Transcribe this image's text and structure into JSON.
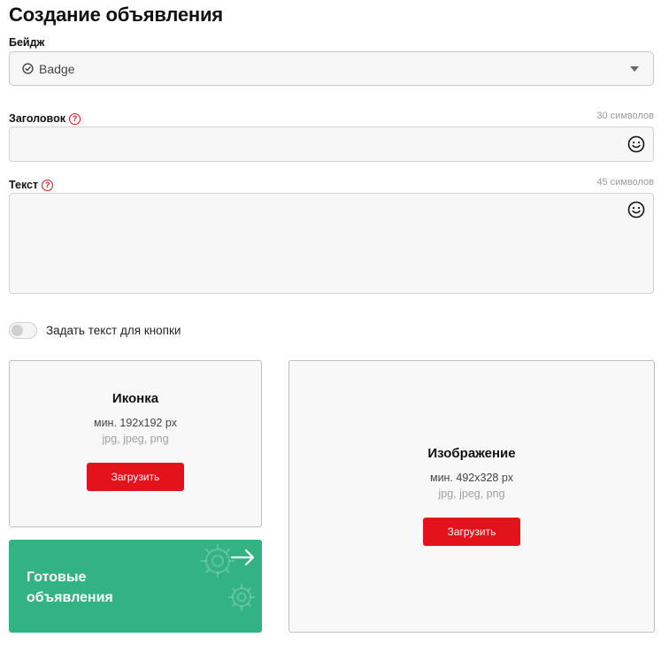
{
  "page": {
    "title": "Создание объявления"
  },
  "badge": {
    "label": "Бейдж",
    "value": "Badge"
  },
  "headline": {
    "label": "Заголовок",
    "counter": "30 символов",
    "value": ""
  },
  "text": {
    "label": "Текст",
    "counter": "45 символов",
    "value": ""
  },
  "button_text_toggle": {
    "label": "Задать текст для кнопки",
    "enabled": false
  },
  "icon_upload": {
    "title": "Иконка",
    "size": "мин. 192x192 px",
    "formats": "jpg, jpeg, png",
    "button": "Загрузить"
  },
  "image_upload": {
    "title": "Изображение",
    "size": "мин. 492x328 px",
    "formats": "jpg, jpeg, png",
    "button": "Загрузить"
  },
  "banner": {
    "line1": "Готовые",
    "line2": "объявления"
  },
  "colors": {
    "accent": "#e3121b",
    "banner": "#33b283",
    "help": "#d8141c"
  },
  "icons": {
    "help": "question-circle",
    "emoji": "smiley",
    "badge": "check-circle",
    "arrow": "arrow-right",
    "gear": "gear"
  }
}
